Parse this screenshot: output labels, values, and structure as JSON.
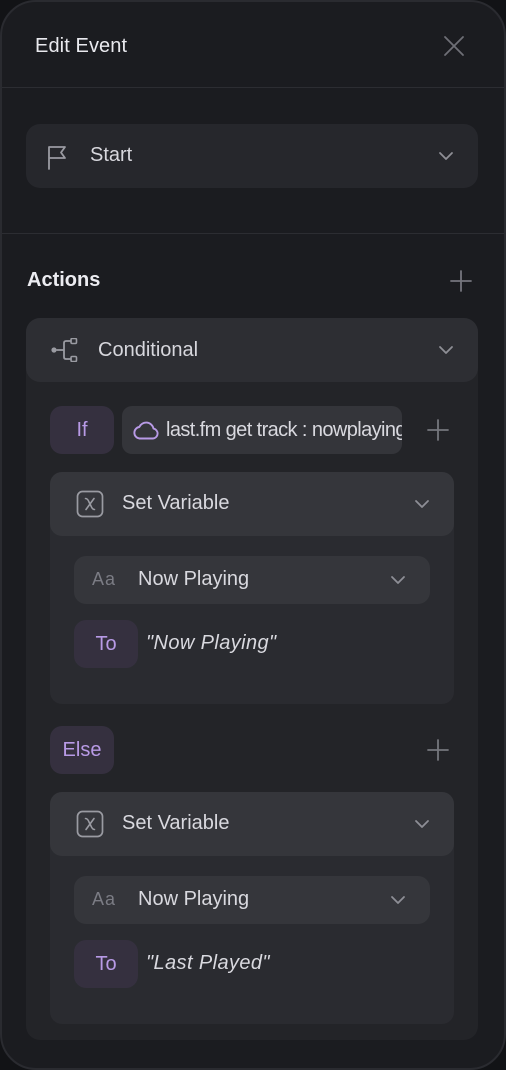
{
  "header": {
    "title": "Edit Event",
    "close_icon": "close-icon"
  },
  "trigger": {
    "icon": "flag-icon",
    "value": "Start"
  },
  "actions": {
    "title": "Actions",
    "add_icon": "plus-icon"
  },
  "conditional": {
    "icon": "branch-icon",
    "label": "Conditional",
    "if_label": "If",
    "condition_icon": "cloud-icon",
    "condition_text": "last.fm get track : nowplaying",
    "else_label": "Else",
    "if_action": {
      "icon": "variable-x-icon",
      "label": "Set Variable",
      "variable_type_icon": "Aa",
      "variable_name": "Now Playing",
      "to_label": "To",
      "to_value": "\"Now Playing\""
    },
    "else_action": {
      "icon": "variable-x-icon",
      "label": "Set Variable",
      "variable_type_icon": "Aa",
      "variable_name": "Now Playing",
      "to_label": "To",
      "to_value": "\"Last Played\""
    }
  },
  "colors": {
    "accent_purple": "#b89ae6",
    "pill_bg": "#35303f",
    "panel_bg": "#1b1c20"
  }
}
